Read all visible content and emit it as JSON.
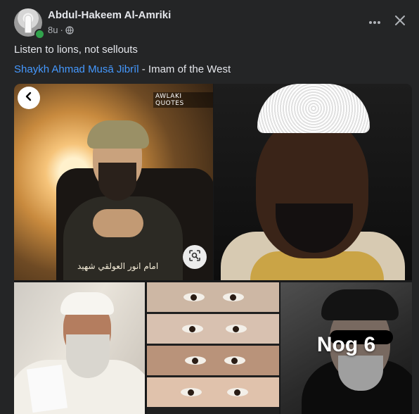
{
  "post": {
    "author": "Abdul-Hakeem Al-Amriki",
    "time": "8u",
    "separator": "·",
    "privacy_icon": "globe-icon",
    "text": "Listen to lions, not sellouts",
    "link_text": "Shaykh Ahmad Musā Jibrīl",
    "link_suffix": " - Imam of the West"
  },
  "header_actions": {
    "more_icon": "more-horizontal-icon",
    "close_icon": "close-icon"
  },
  "media": {
    "photo1": {
      "watermark": "AWLAKI QUOTES",
      "arabic_caption": "امام انور العولقي شهيد"
    },
    "extra_photos_label": "Nog 6"
  },
  "colors": {
    "background": "#242526",
    "text": "#e4e6eb",
    "secondary_text": "#b0b3b8",
    "link": "#4599ff",
    "online": "#31a24c"
  }
}
